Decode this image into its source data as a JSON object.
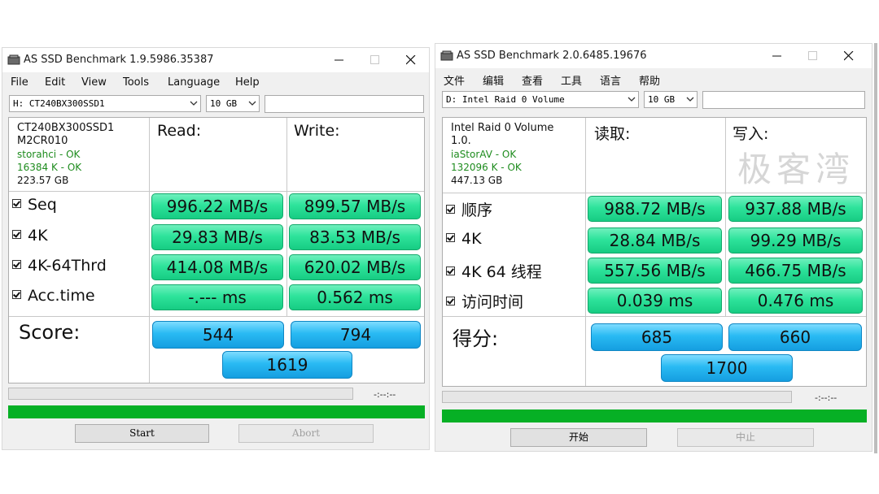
{
  "left": {
    "title": "AS SSD Benchmark 1.9.5986.35387",
    "menu": [
      "File",
      "Edit",
      "View",
      "Tools",
      "Language",
      "Help"
    ],
    "drive_select": "H: CT240BX300SSD1",
    "size_select": "10 GB",
    "info": {
      "model": "CT240BX300SSD1",
      "firmware": "M2CR010",
      "driver": "storahci - OK",
      "alignment": "16384 K - OK",
      "capacity": "223.57 GB"
    },
    "read_header": "Read:",
    "write_header": "Write:",
    "rows": [
      {
        "label": "Seq",
        "read": "996.22 MB/s",
        "write": "899.57 MB/s"
      },
      {
        "label": "4K",
        "read": "29.83 MB/s",
        "write": "83.53 MB/s"
      },
      {
        "label": "4K-64Thrd",
        "read": "414.08 MB/s",
        "write": "620.02 MB/s"
      },
      {
        "label": "Acc.time",
        "read": "-.--- ms",
        "write": "0.562 ms"
      }
    ],
    "score_label": "Score:",
    "score_read": "544",
    "score_write": "794",
    "score_total": "1619",
    "timer": "-:--:--",
    "start_button": "Start",
    "abort_button": "Abort"
  },
  "right": {
    "title": "AS SSD Benchmark 2.0.6485.19676",
    "menu": [
      "文件",
      "编辑",
      "查看",
      "工具",
      "语言",
      "帮助"
    ],
    "drive_select": "D: Intel Raid 0 Volume",
    "size_select": "10 GB",
    "info": {
      "model": "Intel Raid 0 Volume",
      "firmware": "1.0.",
      "driver": "iaStorAV - OK",
      "alignment": "132096 K - OK",
      "capacity": "447.13 GB"
    },
    "read_header": "读取:",
    "write_header": "写入:",
    "watermark": "极客湾",
    "rows": [
      {
        "label": "顺序",
        "read": "988.72 MB/s",
        "write": "937.88 MB/s"
      },
      {
        "label": "4K",
        "read": "28.84 MB/s",
        "write": "99.29 MB/s"
      },
      {
        "label": "4K 64 线程",
        "read": "557.56 MB/s",
        "write": "466.75 MB/s"
      },
      {
        "label": "访问时间",
        "read": "0.039 ms",
        "write": "0.476 ms"
      }
    ],
    "score_label": "得分:",
    "score_read": "685",
    "score_write": "660",
    "score_total": "1700",
    "timer": "-:--:--",
    "start_button": "开始",
    "abort_button": "中止"
  },
  "colors": {
    "result_green": "#2ee39b",
    "score_blue": "#29baf3",
    "progress_green": "#06b025"
  }
}
